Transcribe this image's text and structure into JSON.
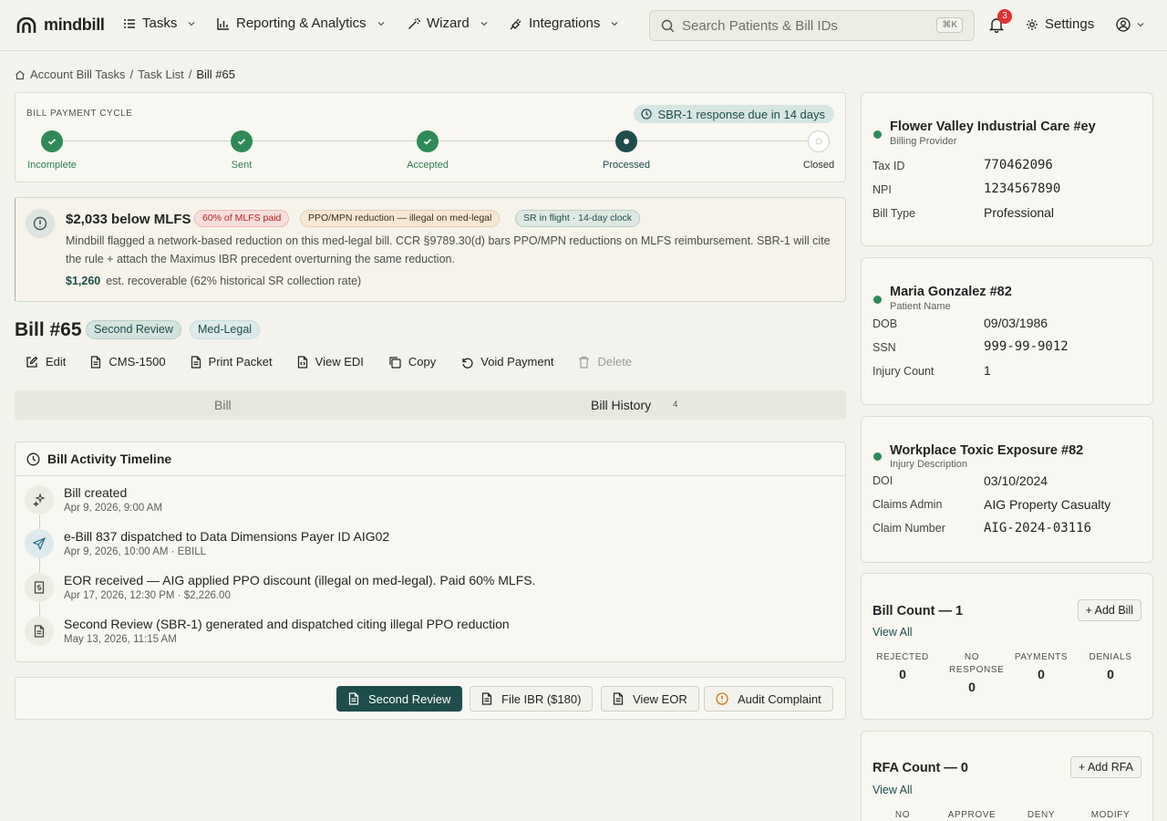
{
  "app": {
    "name": "mindbill"
  },
  "nav": {
    "items": [
      {
        "label": "Tasks",
        "icon": "task-list-icon"
      },
      {
        "label": "Reporting & Analytics",
        "icon": "bar-chart-icon"
      },
      {
        "label": "Wizard",
        "icon": "magic-wand-icon"
      },
      {
        "label": "Integrations",
        "icon": "plug-icon"
      }
    ],
    "search_placeholder": "Search Patients & Bill IDs",
    "search_shortcut": "⌘K",
    "notification_count": "3",
    "settings_label": "Settings"
  },
  "breadcrumb": {
    "items": [
      "Account Bill Tasks",
      "Task List"
    ],
    "current": "Bill #65",
    "separator": "/"
  },
  "payment_cycle": {
    "label": "BILL PAYMENT CYCLE",
    "due_notice": "SBR-1 response due in 14 days",
    "steps": [
      {
        "label": "Incomplete",
        "state": "done"
      },
      {
        "label": "Sent",
        "state": "done"
      },
      {
        "label": "Accepted",
        "state": "done"
      },
      {
        "label": "Processed",
        "state": "current"
      },
      {
        "label": "Closed",
        "state": "future"
      }
    ]
  },
  "alert": {
    "title": "$2,033 below MLFS",
    "tags": [
      "60% of MLFS paid",
      "PPO/MPN reduction — illegal on med-legal",
      "SR in flight · 14-day clock"
    ],
    "body": "Mindbill flagged a network-based reduction on this med-legal bill. CCR §9789.30(d) bars PPO/MPN reductions on MLFS reimbursement. SBR-1 will cite the rule + attach the Maximus IBR precedent overturning the same reduction.",
    "recover_amount": "$1,260",
    "recover_text": "est. recoverable (62% historical SR collection rate)"
  },
  "bill": {
    "title": "Bill #65",
    "tags": [
      "Second Review",
      "Med-Legal"
    ],
    "actions": [
      "Edit",
      "CMS-1500",
      "Print Packet",
      "View EDI",
      "Copy",
      "Void Payment",
      "Delete"
    ]
  },
  "tabs": {
    "bill": "Bill",
    "history": "Bill History",
    "history_count": "4"
  },
  "timeline": {
    "title": "Bill Activity Timeline",
    "events": [
      {
        "title": "Bill created",
        "sub": "Apr 9, 2026, 9:00 AM",
        "icon": "sparkle-icon"
      },
      {
        "title": "e-Bill 837 dispatched to Data Dimensions Payer ID AIG02",
        "sub": "Apr 9, 2026, 10:00 AM · EBILL",
        "icon": "send-icon"
      },
      {
        "title": "EOR received — AIG applied PPO discount (illegal on med-legal). Paid 60% MLFS.",
        "sub": "Apr 17, 2026, 12:30 PM · $2,226.00",
        "icon": "dollar-document-icon"
      },
      {
        "title": "Second Review (SBR-1) generated and dispatched citing illegal PPO reduction",
        "sub": "May 13, 2026, 11:15 AM",
        "icon": "document-icon"
      }
    ]
  },
  "footer_actions": [
    "Second Review",
    "File IBR ($180)",
    "View EOR",
    "Audit Complaint"
  ],
  "provider": {
    "name": "Flower Valley Industrial Care #ey",
    "role": "Billing Provider",
    "fields": [
      {
        "k": "Tax ID",
        "v": "770462096"
      },
      {
        "k": "NPI",
        "v": "1234567890"
      },
      {
        "k": "Bill Type",
        "v": "Professional"
      }
    ]
  },
  "patient": {
    "name": "Maria Gonzalez #82",
    "role": "Patient Name",
    "fields": [
      {
        "k": "DOB",
        "v": "09/03/1986"
      },
      {
        "k": "SSN",
        "v": "999-99-9012"
      },
      {
        "k": "Injury Count",
        "v": "1"
      }
    ]
  },
  "injury": {
    "name": "Workplace Toxic Exposure #82",
    "role": "Injury Description",
    "fields": [
      {
        "k": "DOI",
        "v": "03/10/2024"
      },
      {
        "k": "Claims Admin",
        "v": "AIG Property Casualty"
      },
      {
        "k": "Claim Number",
        "v": "AIG-2024-03116"
      }
    ]
  },
  "bill_count": {
    "title": "Bill Count — 1",
    "add_label": "+ Add Bill",
    "view_all": "View All",
    "stats": [
      {
        "label": "REJECTED",
        "value": "0"
      },
      {
        "label": "NO RESPONSE",
        "value": "0"
      },
      {
        "label": "PAYMENTS",
        "value": "0"
      },
      {
        "label": "DENIALS",
        "value": "0"
      }
    ]
  },
  "rfa_count": {
    "title": "RFA Count — 0",
    "add_label": "+ Add RFA",
    "view_all": "View All",
    "stats": [
      {
        "label": "NO"
      },
      {
        "label": "APPROVE"
      },
      {
        "label": "DENY"
      },
      {
        "label": "MODIFY"
      }
    ]
  },
  "colors": {
    "accent": "#1e4d4b",
    "success": "#2e8b57",
    "danger": "#e03131",
    "background": "#f3f2ec"
  }
}
